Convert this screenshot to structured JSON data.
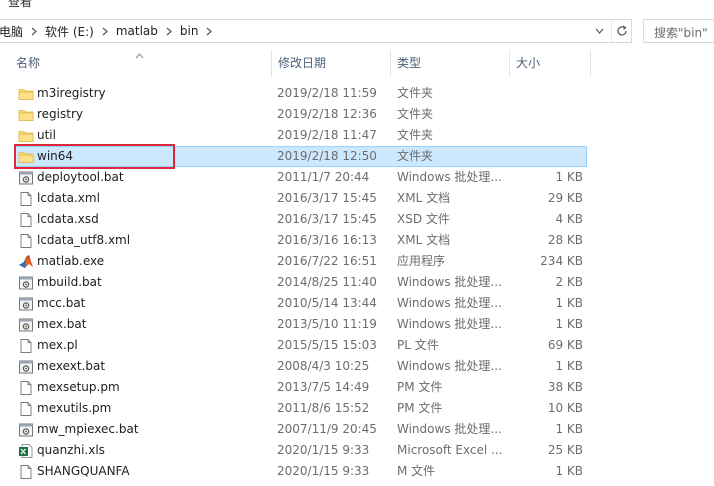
{
  "ribbon": {
    "view_tab": "查看"
  },
  "address_bar": {
    "breadcrumbs": [
      "电脑",
      "软件 (E:)",
      "matlab",
      "bin"
    ]
  },
  "search": {
    "placeholder": "搜索\"bin\""
  },
  "columns": {
    "name": "名称",
    "date": "修改日期",
    "type": "类型",
    "size": "大小"
  },
  "files": [
    {
      "icon": "folder-icon",
      "name": "m3iregistry",
      "date": "2019/2/18 11:59",
      "type": "文件夹",
      "size": ""
    },
    {
      "icon": "folder-icon",
      "name": "registry",
      "date": "2019/2/18 12:36",
      "type": "文件夹",
      "size": ""
    },
    {
      "icon": "folder-icon",
      "name": "util",
      "date": "2019/2/18 11:47",
      "type": "文件夹",
      "size": ""
    },
    {
      "icon": "folder-icon",
      "name": "win64",
      "date": "2019/2/18 12:50",
      "type": "文件夹",
      "size": "",
      "selected": true
    },
    {
      "icon": "batch-file-icon",
      "name": "deploytool.bat",
      "date": "2011/1/7 20:44",
      "type": "Windows 批处理...",
      "size": "1 KB"
    },
    {
      "icon": "document-icon",
      "name": "lcdata.xml",
      "date": "2016/3/17 15:45",
      "type": "XML 文档",
      "size": "29 KB"
    },
    {
      "icon": "document-icon",
      "name": "lcdata.xsd",
      "date": "2016/3/17 15:45",
      "type": "XSD 文件",
      "size": "4 KB"
    },
    {
      "icon": "document-icon",
      "name": "lcdata_utf8.xml",
      "date": "2016/3/16 16:13",
      "type": "XML 文档",
      "size": "28 KB"
    },
    {
      "icon": "matlab-logo-icon",
      "name": "matlab.exe",
      "date": "2016/7/22 16:51",
      "type": "应用程序",
      "size": "234 KB"
    },
    {
      "icon": "batch-file-icon",
      "name": "mbuild.bat",
      "date": "2014/8/25 11:40",
      "type": "Windows 批处理...",
      "size": "2 KB"
    },
    {
      "icon": "batch-file-icon",
      "name": "mcc.bat",
      "date": "2010/5/14 13:44",
      "type": "Windows 批处理...",
      "size": "1 KB"
    },
    {
      "icon": "batch-file-icon",
      "name": "mex.bat",
      "date": "2013/5/10 11:19",
      "type": "Windows 批处理...",
      "size": "1 KB"
    },
    {
      "icon": "document-icon",
      "name": "mex.pl",
      "date": "2015/5/15 15:03",
      "type": "PL 文件",
      "size": "69 KB"
    },
    {
      "icon": "batch-file-icon",
      "name": "mexext.bat",
      "date": "2008/4/3 10:25",
      "type": "Windows 批处理...",
      "size": "1 KB"
    },
    {
      "icon": "document-icon",
      "name": "mexsetup.pm",
      "date": "2013/7/5 14:49",
      "type": "PM 文件",
      "size": "38 KB"
    },
    {
      "icon": "document-icon",
      "name": "mexutils.pm",
      "date": "2011/8/6 15:52",
      "type": "PM 文件",
      "size": "10 KB"
    },
    {
      "icon": "batch-file-icon",
      "name": "mw_mpiexec.bat",
      "date": "2007/11/9 20:45",
      "type": "Windows 批处理...",
      "size": "1 KB"
    },
    {
      "icon": "excel-file-icon",
      "name": "quanzhi.xls",
      "date": "2020/1/15 9:33",
      "type": "Microsoft Excel ...",
      "size": "25 KB"
    },
    {
      "icon": "document-icon",
      "name": "SHANGQUANFA",
      "date": "2020/1/15 9:33",
      "type": "M 文件",
      "size": "1 KB"
    }
  ]
}
